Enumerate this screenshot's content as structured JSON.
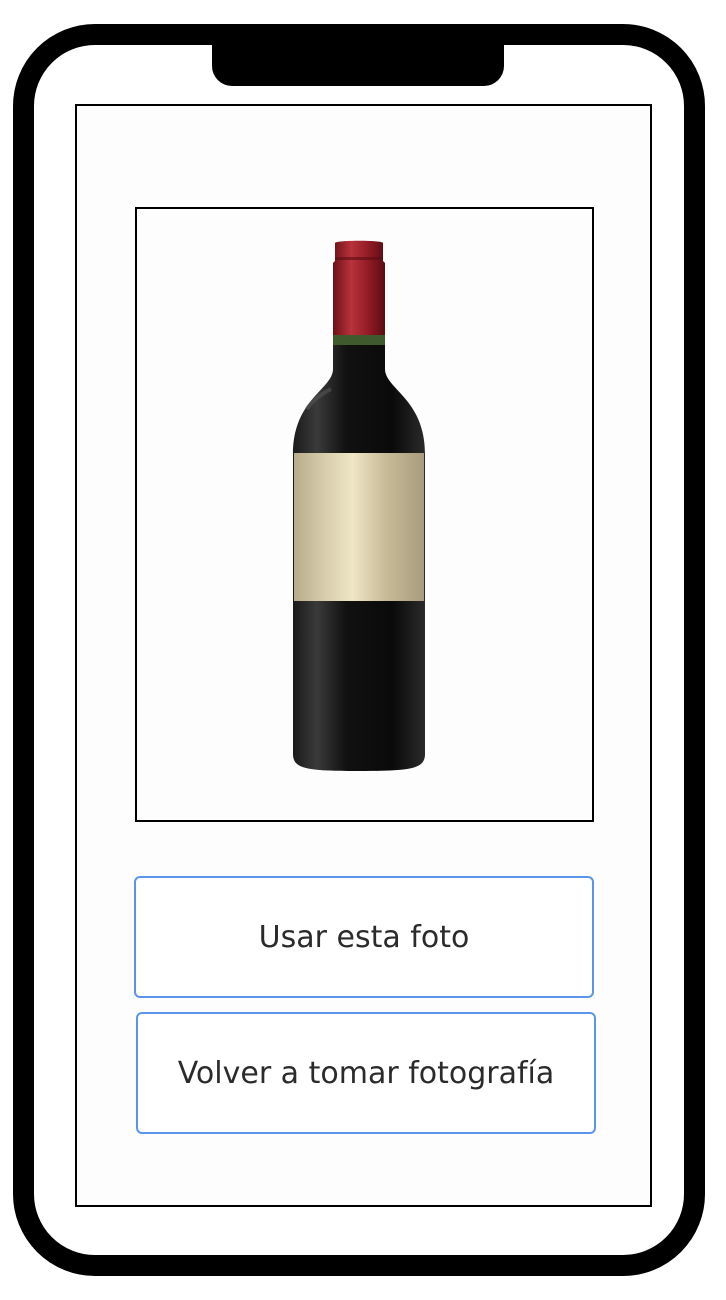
{
  "buttons": {
    "use_photo": "Usar esta foto",
    "retake_photo": "Volver a tomar fotografía"
  },
  "colors": {
    "button_border": "#5b95ea",
    "device_frame": "#000000",
    "capsule": "#a8232e",
    "bottle_glass": "#0e0e0e",
    "label": "#d6c9a4"
  }
}
